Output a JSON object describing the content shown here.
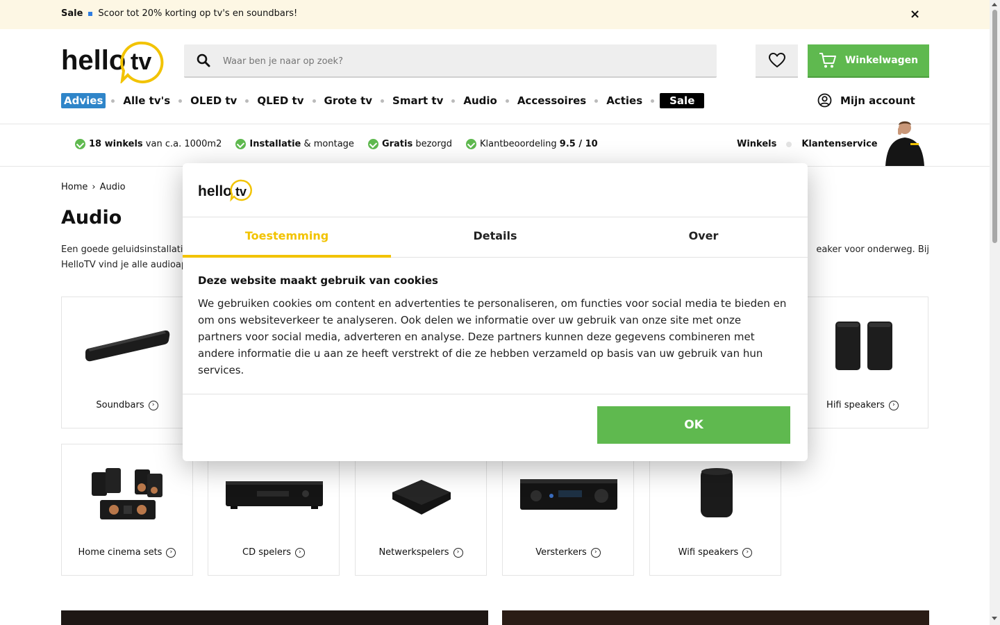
{
  "promo": {
    "sale": "Sale",
    "text": "Scoor tot 20% korting op tv's en soundbars!",
    "close": "×"
  },
  "logo": {
    "part1": "hello",
    "part2": "tv"
  },
  "search": {
    "placeholder": "Waar ben je naar op zoek?"
  },
  "cart": {
    "label": "Winkelwagen"
  },
  "nav": {
    "items": [
      "Advies",
      "Alle tv's",
      "OLED tv",
      "QLED tv",
      "Grote tv",
      "Smart tv",
      "Audio",
      "Accessoires",
      "Acties",
      "Sale"
    ]
  },
  "account": {
    "label": "Mijn account"
  },
  "usp": {
    "u1_bold": "18 winkels",
    "u1_rest": " van c.a. 1000m2",
    "u2_bold": "Installatie",
    "u2_rest": " & montage",
    "u3_bold": "Gratis",
    "u3_rest": " bezorgd",
    "u4_rest": "Klantbeoordeling ",
    "u4_bold": "9.5 / 10",
    "link1": "Winkels",
    "link2": "Klantenservice"
  },
  "breadcrumb": {
    "home": "Home",
    "sep": "›",
    "current": "Audio"
  },
  "page": {
    "title": "Audio",
    "intro_left": "Een goede geluidsinstallatie",
    "intro_right": "eaker voor onderweg. Bij",
    "intro_line2": "HelloTV vind je alle audioap"
  },
  "categories": {
    "soundbars": "Soundbars",
    "hifi": "Hifi speakers",
    "homecinema": "Home cinema sets",
    "cd": "CD spelers",
    "netwerk": "Netwerkspelers",
    "versterkers": "Versterkers",
    "wifi": "Wifi speakers"
  },
  "cookie": {
    "tabs": [
      "Toestemming",
      "Details",
      "Over"
    ],
    "heading": "Deze website maakt gebruik van cookies",
    "text": "We gebruiken cookies om content en advertenties te personaliseren, om functies voor social media te bieden en om ons websiteverkeer te analyseren. Ook delen we informatie over uw gebruik van onze site met onze partners voor social media, adverteren en analyse. Deze partners kunnen deze gegevens combineren met andere informatie die u aan ze heeft verstrekt of die ze hebben verzameld op basis van uw gebruik van hun services.",
    "ok": "OK"
  },
  "colors": {
    "brand_yellow": "#f2c300",
    "green": "#5fb94f",
    "advies_blue": "#2f85c9",
    "promo_bg": "#fdf7e4"
  }
}
